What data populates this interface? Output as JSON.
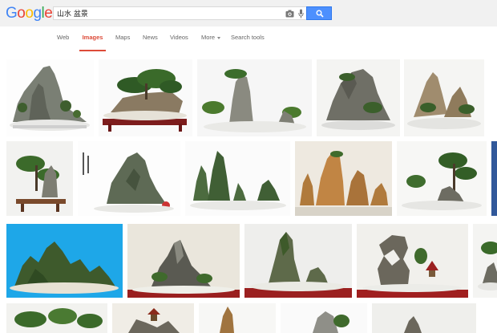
{
  "logo": {
    "letters": [
      "G",
      "o",
      "o",
      "g",
      "l",
      "e"
    ],
    "colors": [
      "#4285f4",
      "#ea4335",
      "#fbbc05",
      "#4285f4",
      "#34a853",
      "#ea4335"
    ]
  },
  "search": {
    "query": "山水 盆景"
  },
  "nav": {
    "web": "Web",
    "images": "Images",
    "maps": "Maps",
    "news": "News",
    "videos": "Videos",
    "more": "More",
    "search_tools": "Search tools"
  },
  "colors": {
    "accent": "#dd4b39",
    "search_button": "#4d90fe"
  },
  "thumbnails": [
    {
      "scene": "ridge-white"
    },
    {
      "scene": "slab-tree"
    },
    {
      "scene": "tall-rock"
    },
    {
      "scene": "grey-craggy"
    },
    {
      "scene": "pale-rocks"
    },
    {
      "scene": "pine-tray"
    },
    {
      "scene": "calligraphy-rock"
    },
    {
      "scene": "green-spires"
    },
    {
      "scene": "orange-spires"
    },
    {
      "scene": "pine-grove"
    },
    {
      "scene": "blue-mountains"
    },
    {
      "scene": "grey-boulder"
    },
    {
      "scene": "mossy-peak"
    },
    {
      "scene": "arch-pavilion"
    },
    {
      "scene": "edge-tree"
    },
    {
      "scene": "tree-row"
    },
    {
      "scene": "pavilion-rock"
    },
    {
      "scene": "tall-thin"
    },
    {
      "scene": "white-rocks"
    },
    {
      "scene": "small-peak"
    }
  ]
}
